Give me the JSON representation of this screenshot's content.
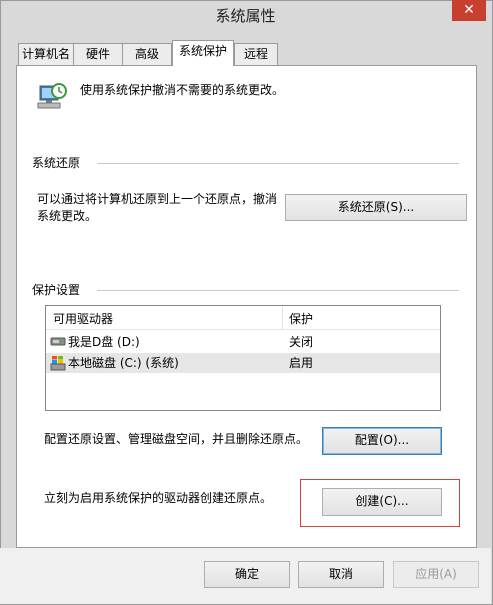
{
  "window": {
    "title": "系统属性",
    "close_symbol": "✕"
  },
  "tabs": [
    {
      "label": "计算机名",
      "active": false
    },
    {
      "label": "硬件",
      "active": false
    },
    {
      "label": "高级",
      "active": false
    },
    {
      "label": "系统保护",
      "active": true
    },
    {
      "label": "远程",
      "active": false
    }
  ],
  "intro": {
    "text": "使用系统保护撤消不需要的系统更改。",
    "icon": "system-protection-icon"
  },
  "restore": {
    "section_title": "系统还原",
    "desc_line1": "可以通过将计算机还原到上一个还原点，撤消",
    "desc_line2": "系统更改。",
    "button": "系统还原(S)..."
  },
  "protection": {
    "section_title": "保护设置",
    "columns": [
      "可用驱动器",
      "保护"
    ],
    "drives": [
      {
        "name": "我是D盘 (D:)",
        "protection": "关闭",
        "icon": "removable-drive-icon",
        "selected": false
      },
      {
        "name": "本地磁盘 (C:) (系统)",
        "protection": "启用",
        "icon": "system-drive-icon",
        "selected": true
      }
    ],
    "configure_desc": "配置还原设置、管理磁盘空间，并且删除还原点。",
    "configure_button": "配置(O)...",
    "create_desc": "立刻为启用系统保护的驱动器创建还原点。",
    "create_button": "创建(C)..."
  },
  "footer": {
    "ok": "确定",
    "cancel": "取消",
    "apply": "应用(A)"
  },
  "colors": {
    "highlight": "#d9423a",
    "close": "#c7402f",
    "focus": "#3c7fb1"
  }
}
